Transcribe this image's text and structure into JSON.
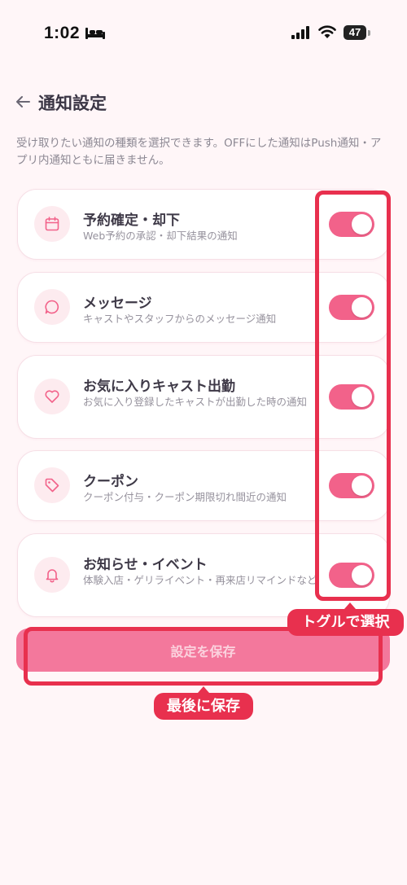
{
  "status_bar": {
    "time": "1:02",
    "battery": "47"
  },
  "header": {
    "title": "通知設定",
    "back_icon": "arrow-left-icon"
  },
  "description": "受け取りたい通知の種類を選択できます。OFFにした通知はPush通知・アプリ内通知ともに届きません。",
  "settings": [
    {
      "title": "予約確定・却下",
      "desc": "Web予約の承認・却下結果の通知",
      "icon": "calendar-icon",
      "enabled": true
    },
    {
      "title": "メッセージ",
      "desc": "キャストやスタッフからのメッセージ通知",
      "icon": "chat-bubble-icon",
      "enabled": true
    },
    {
      "title": "お気に入りキャスト出勤",
      "desc": "お気に入り登録したキャストが出勤した時の通知",
      "icon": "heart-icon",
      "enabled": true
    },
    {
      "title": "クーポン",
      "desc": "クーポン付与・クーポン期限切れ間近の通知",
      "icon": "tag-icon",
      "enabled": true
    },
    {
      "title": "お知らせ・イベント",
      "desc": "体験入店・ゲリライベント・再来店リマインドなど",
      "icon": "bell-icon",
      "enabled": true
    }
  ],
  "save_label": "設定を保存",
  "annotations": {
    "toggle_callout": "トグルで選択",
    "save_callout": "最後に保存"
  },
  "colors": {
    "accent": "#f2628a",
    "highlight": "#e8304e",
    "background": "#fff6f8"
  }
}
